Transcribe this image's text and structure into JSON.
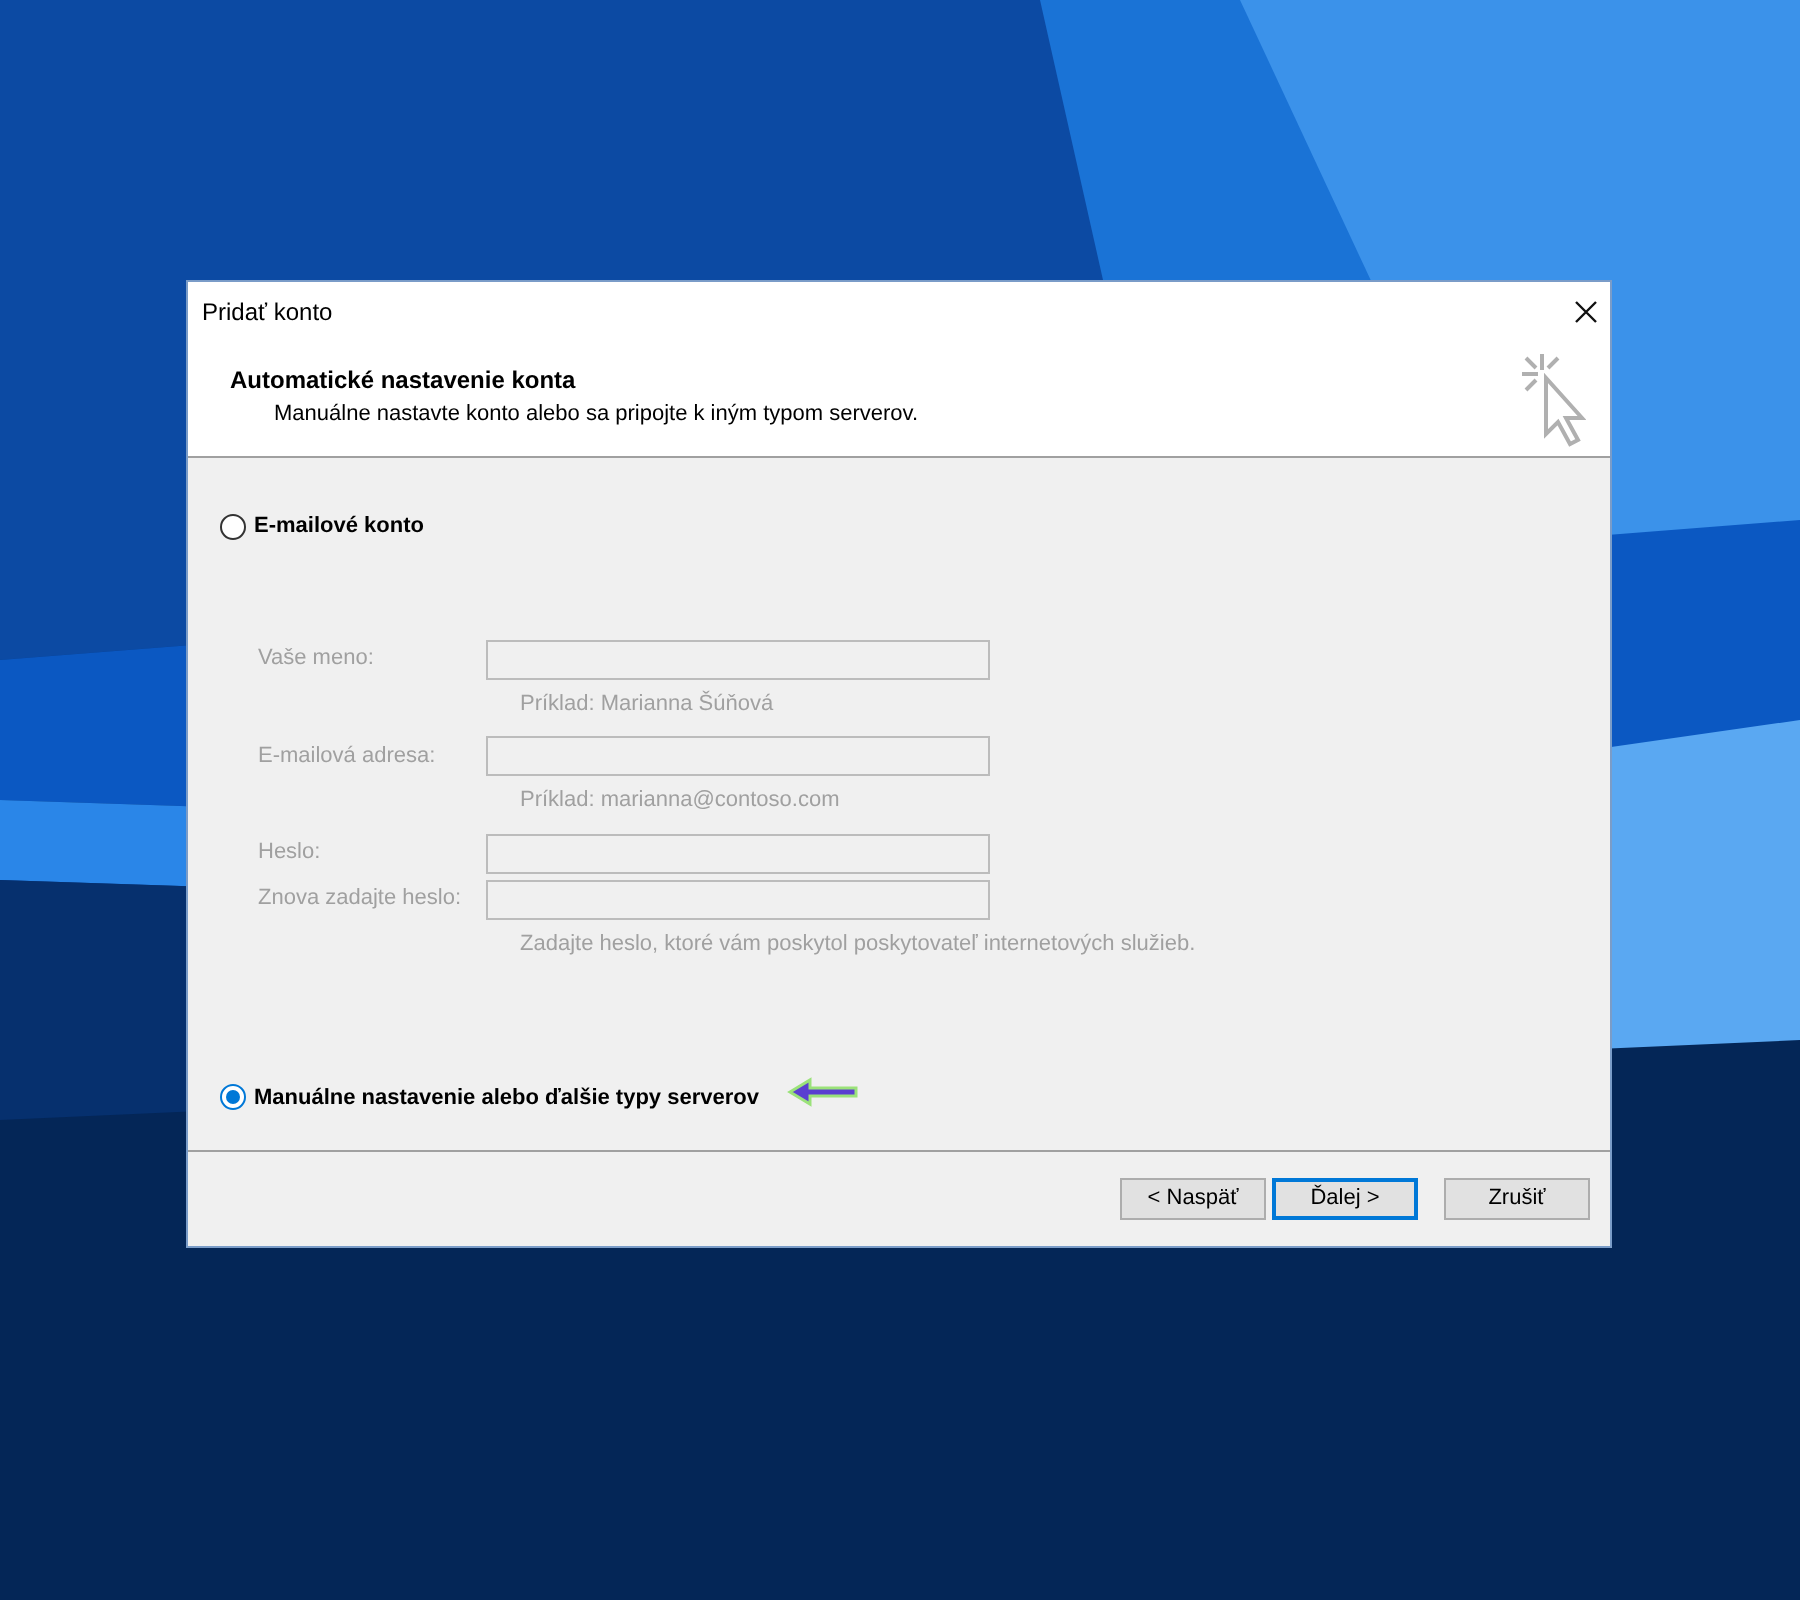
{
  "window": {
    "title": "Pridať konto"
  },
  "header": {
    "title": "Automatické nastavenie konta",
    "subtitle": "Manuálne nastavte konto alebo sa pripojte k iným typom serverov."
  },
  "options": [
    {
      "label": "E-mailové konto",
      "selected": false,
      "kind": "form",
      "disabled": true,
      "fields": [
        {
          "label": "Vaše meno:",
          "hint": "Príklad: Marianna Šúňová"
        },
        {
          "label": "E-mailová adresa:",
          "hint": "Príklad: marianna@contoso.com"
        },
        {
          "label": "Heslo:"
        },
        {
          "label": "Znova zadajte heslo:",
          "hint": "Zadajte heslo, ktoré vám poskytol poskytovateľ internetových služieb."
        }
      ]
    },
    {
      "label": "Manuálne nastavenie alebo ďalšie typy serverov",
      "selected": true,
      "kind": "annotated"
    }
  ],
  "buttons": [
    {
      "label": "< Naspäť",
      "default": false
    },
    {
      "label": "Ďalej >",
      "default": true
    },
    {
      "label": "Zrušiť",
      "default": false
    }
  ]
}
